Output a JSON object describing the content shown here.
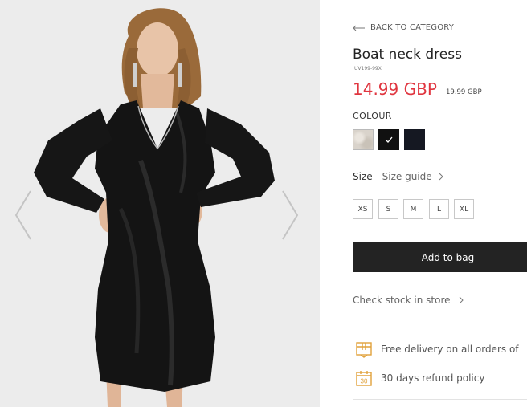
{
  "gallery": {
    "prev_icon": "chevron-left-icon",
    "next_icon": "chevron-right-icon"
  },
  "product": {
    "back_label": "BACK TO CATEGORY",
    "title": "Boat neck dress",
    "sku": "UV199-99X",
    "price": "14.99 GBP",
    "old_price": "19.99 GBP",
    "price_color": "#e0353f",
    "colour_label": "COLOUR",
    "colours": [
      {
        "name": "beige-melange",
        "hex": "#d9d3cb",
        "selected": false
      },
      {
        "name": "black",
        "hex": "#111111",
        "selected": true
      },
      {
        "name": "navy",
        "hex": "#151822",
        "selected": false
      }
    ],
    "size_label": "Size",
    "size_guide": "Size guide",
    "sizes": [
      "XS",
      "S",
      "M",
      "L",
      "XL"
    ],
    "add_to_bag": "Add to bag",
    "check_stock": "Check stock in store",
    "perks": [
      {
        "icon": "delivery-box-icon",
        "text": "Free delivery on all orders of"
      },
      {
        "icon": "calendar-30-icon",
        "text": "30 days refund policy"
      }
    ]
  }
}
